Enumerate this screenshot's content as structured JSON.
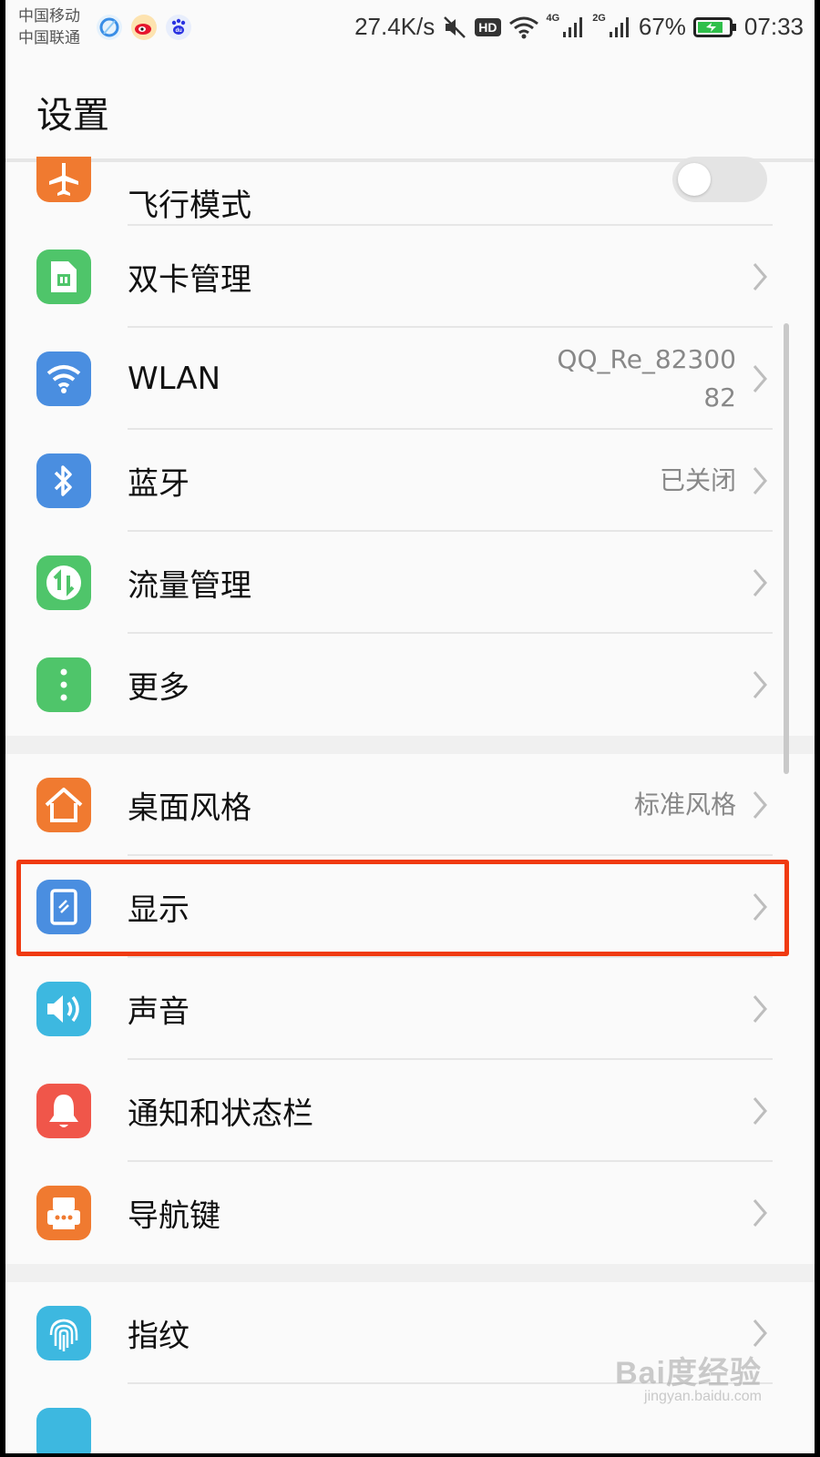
{
  "status_bar": {
    "carrier1": "中国移动",
    "carrier2": "中国联通",
    "network_speed": "27.4K/s",
    "hd_badge": "HD",
    "sim1_type": "4G",
    "sim2_type": "2G",
    "battery_percent": "67%",
    "time": "07:33",
    "app_icons": [
      "browser-icon",
      "weibo-icon",
      "baidu-icon"
    ]
  },
  "header": {
    "title": "设置"
  },
  "settings": {
    "airplane": {
      "label": "飞行模式",
      "enabled": false,
      "icon": "airplane-icon",
      "color": "#f07a30"
    },
    "group1": [
      {
        "label": "双卡管理",
        "value": "",
        "icon": "sim-icon",
        "color": "#4fc56a"
      },
      {
        "label": "WLAN",
        "value": "QQ_Re_82300\n82",
        "value_line1": "QQ_Re_82300",
        "value_line2": "82",
        "icon": "wifi-icon",
        "color": "#4a8ee0"
      },
      {
        "label": "蓝牙",
        "value": "已关闭",
        "icon": "bluetooth-icon",
        "color": "#4a8ee0"
      },
      {
        "label": "流量管理",
        "value": "",
        "icon": "data-usage-icon",
        "color": "#4fc56a"
      },
      {
        "label": "更多",
        "value": "",
        "icon": "more-icon",
        "color": "#4fc56a"
      }
    ],
    "group2": [
      {
        "label": "桌面风格",
        "value": "标准风格",
        "icon": "home-icon",
        "color": "#f07a30"
      },
      {
        "label": "显示",
        "value": "",
        "icon": "display-icon",
        "color": "#4a8ee0",
        "highlighted": true
      },
      {
        "label": "声音",
        "value": "",
        "icon": "sound-icon",
        "color": "#3db8e0"
      },
      {
        "label": "通知和状态栏",
        "value": "",
        "icon": "bell-icon",
        "color": "#f0564a"
      },
      {
        "label": "导航键",
        "value": "",
        "icon": "navigation-icon",
        "color": "#f07a30"
      }
    ],
    "group3": [
      {
        "label": "指纹",
        "value": "",
        "icon": "fingerprint-icon",
        "color": "#3db8e0"
      }
    ]
  },
  "watermark": {
    "logo": "Bai度经验",
    "url": "jingyan.baidu.com"
  },
  "colors": {
    "highlight": "#f03a10",
    "background": "#fafafa"
  }
}
